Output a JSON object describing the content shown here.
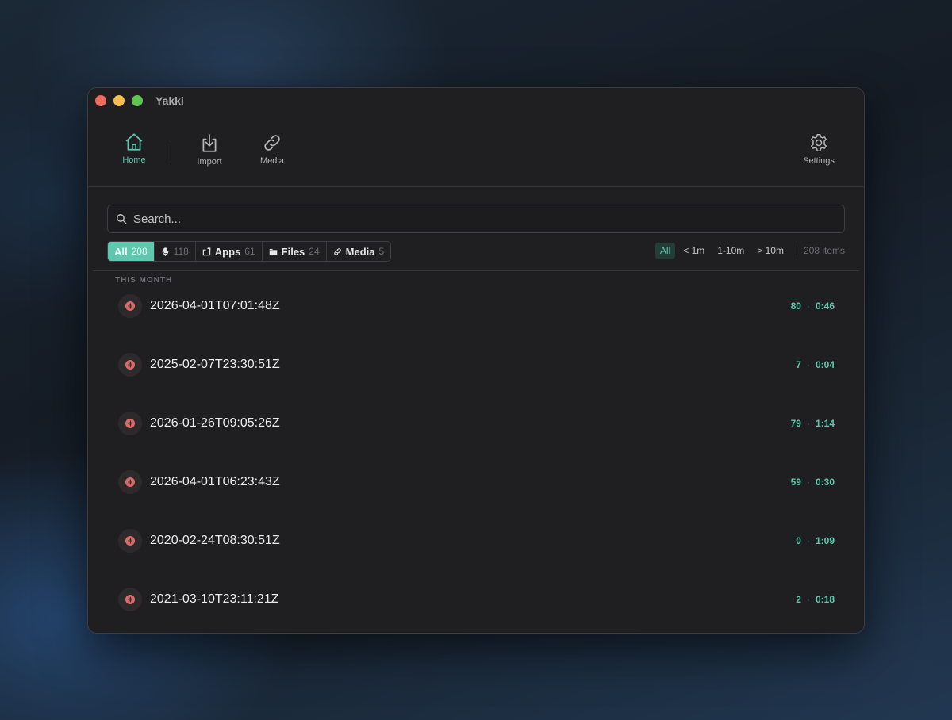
{
  "app": {
    "title": "Yakki"
  },
  "toolbar": {
    "home_label": "Home",
    "import_label": "Import",
    "media_label": "Media",
    "settings_label": "Settings"
  },
  "search": {
    "placeholder": "Search...",
    "value": ""
  },
  "filters": [
    {
      "label": "All",
      "count": "208",
      "icon": "",
      "active": true
    },
    {
      "label": "",
      "count": "118",
      "icon": "microphone-icon",
      "active": false
    },
    {
      "label": "Apps",
      "count": "61",
      "icon": "app-window-icon",
      "active": false
    },
    {
      "label": "Files",
      "count": "24",
      "icon": "folder-icon",
      "active": false
    },
    {
      "label": "Media",
      "count": "5",
      "icon": "link-icon",
      "active": false
    }
  ],
  "durations": [
    {
      "label": "All",
      "active": true
    },
    {
      "label": "< 1m",
      "active": false
    },
    {
      "label": "1-10m",
      "active": false
    },
    {
      "label": "> 10m",
      "active": false
    }
  ],
  "items_count": "208 items",
  "section_label": "THIS MONTH",
  "recordings": [
    {
      "title": "2026-04-01T07:01:48Z",
      "count": "80",
      "duration": "0:46",
      "icon": "audio-wave-icon"
    },
    {
      "title": "2025-02-07T23:30:51Z",
      "count": "7",
      "duration": "0:04",
      "icon": "audio-wave-icon"
    },
    {
      "title": "2026-01-26T09:05:26Z",
      "count": "79",
      "duration": "1:14",
      "icon": "audio-wave-icon"
    },
    {
      "title": "2026-04-01T06:23:43Z",
      "count": "59",
      "duration": "0:30",
      "icon": "audio-wave-icon"
    },
    {
      "title": "2020-02-24T08:30:51Z",
      "count": "0",
      "duration": "1:09",
      "icon": "audio-wave-icon"
    },
    {
      "title": "2021-03-10T23:11:21Z",
      "count": "2",
      "duration": "0:18",
      "icon": "audio-wave-icon"
    }
  ],
  "colors": {
    "accent": "#5ec7ad",
    "window_bg": "#1f1f21",
    "record_icon": "#d86a6a"
  }
}
